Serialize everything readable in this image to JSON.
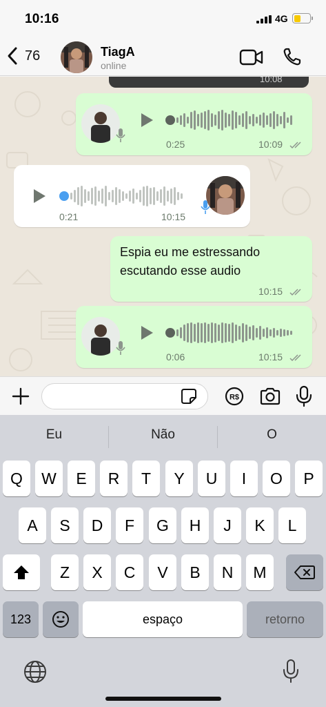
{
  "status_bar": {
    "time": "10:16",
    "network": "4G",
    "battery_color": "#f7c900"
  },
  "header": {
    "back_count": "76",
    "contact_name": "TiagA",
    "contact_status": "online"
  },
  "chat": {
    "top_partial_time": "10:08",
    "messages": [
      {
        "type": "voice",
        "direction": "outgoing",
        "duration": "0:25",
        "time": "10:09"
      },
      {
        "type": "voice",
        "direction": "incoming",
        "duration": "0:21",
        "time": "10:15"
      },
      {
        "type": "text",
        "direction": "outgoing",
        "line1": "Espia eu me estressando",
        "line2": "escutando esse audio",
        "time": "10:15"
      },
      {
        "type": "voice",
        "direction": "outgoing",
        "duration": "0:06",
        "time": "10:15"
      }
    ]
  },
  "keyboard": {
    "suggestions": [
      "Eu",
      "Não",
      "O"
    ],
    "row1": [
      "Q",
      "W",
      "E",
      "R",
      "T",
      "Y",
      "U",
      "I",
      "O",
      "P"
    ],
    "row2": [
      "A",
      "S",
      "D",
      "F",
      "G",
      "H",
      "J",
      "K",
      "L"
    ],
    "row3": [
      "Z",
      "X",
      "C",
      "V",
      "B",
      "N",
      "M"
    ],
    "numbers_key": "123",
    "space_key": "espaço",
    "return_key": "retorno"
  },
  "colors": {
    "outgoing_bubble": "#d9fdd3",
    "incoming_bubble": "#ffffff",
    "accent_blue": "#4a9ff0",
    "wave_gray": "#8d958d"
  }
}
